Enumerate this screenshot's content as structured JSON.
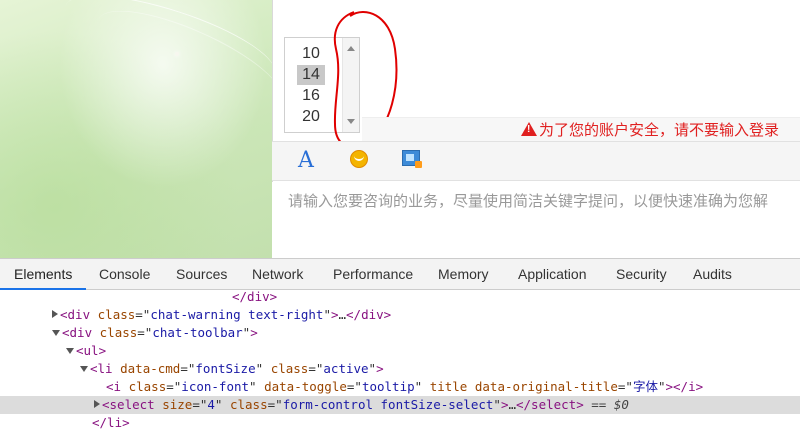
{
  "font_size_select": {
    "options": [
      "10",
      "14",
      "16",
      "20"
    ],
    "selected": "14"
  },
  "chat": {
    "warning": "为了您的账户安全，请不要输入登录",
    "input_placeholder": "请输入您要咨询的业务，尽量使用简洁关键字提问，以便快速准确为您解"
  },
  "toolbar": {
    "font_icon_label": "A"
  },
  "devtools": {
    "tabs": [
      "Elements",
      "Console",
      "Sources",
      "Network",
      "Performance",
      "Memory",
      "Application",
      "Security",
      "Audits"
    ],
    "active_tab": "Elements",
    "dom": {
      "l0_close": "</div>",
      "l1": {
        "tag": "div",
        "attr": "class",
        "val": "chat-warning text-right",
        "ell": "…",
        "close": "</div>"
      },
      "l2": {
        "tag": "div",
        "attr": "class",
        "val": "chat-toolbar"
      },
      "l3": {
        "tag": "ul"
      },
      "l4": {
        "tag": "li",
        "a1": "data-cmd",
        "v1": "fontSize",
        "a2": "class",
        "v2": "active"
      },
      "l5": {
        "tag": "i",
        "a1": "class",
        "v1": "icon-font",
        "a2": "data-toggle",
        "v2": "tooltip",
        "a3": "title",
        "a4": "data-original-title",
        "v4": "字体",
        "close": "</i>"
      },
      "l6": {
        "tag": "select",
        "a1": "size",
        "v1": "4",
        "a2": "class",
        "v2": "form-control fontSize-select",
        "ell": "…",
        "close": "</select>",
        "suffix": "== $0"
      },
      "l7_close": "</li>"
    }
  }
}
